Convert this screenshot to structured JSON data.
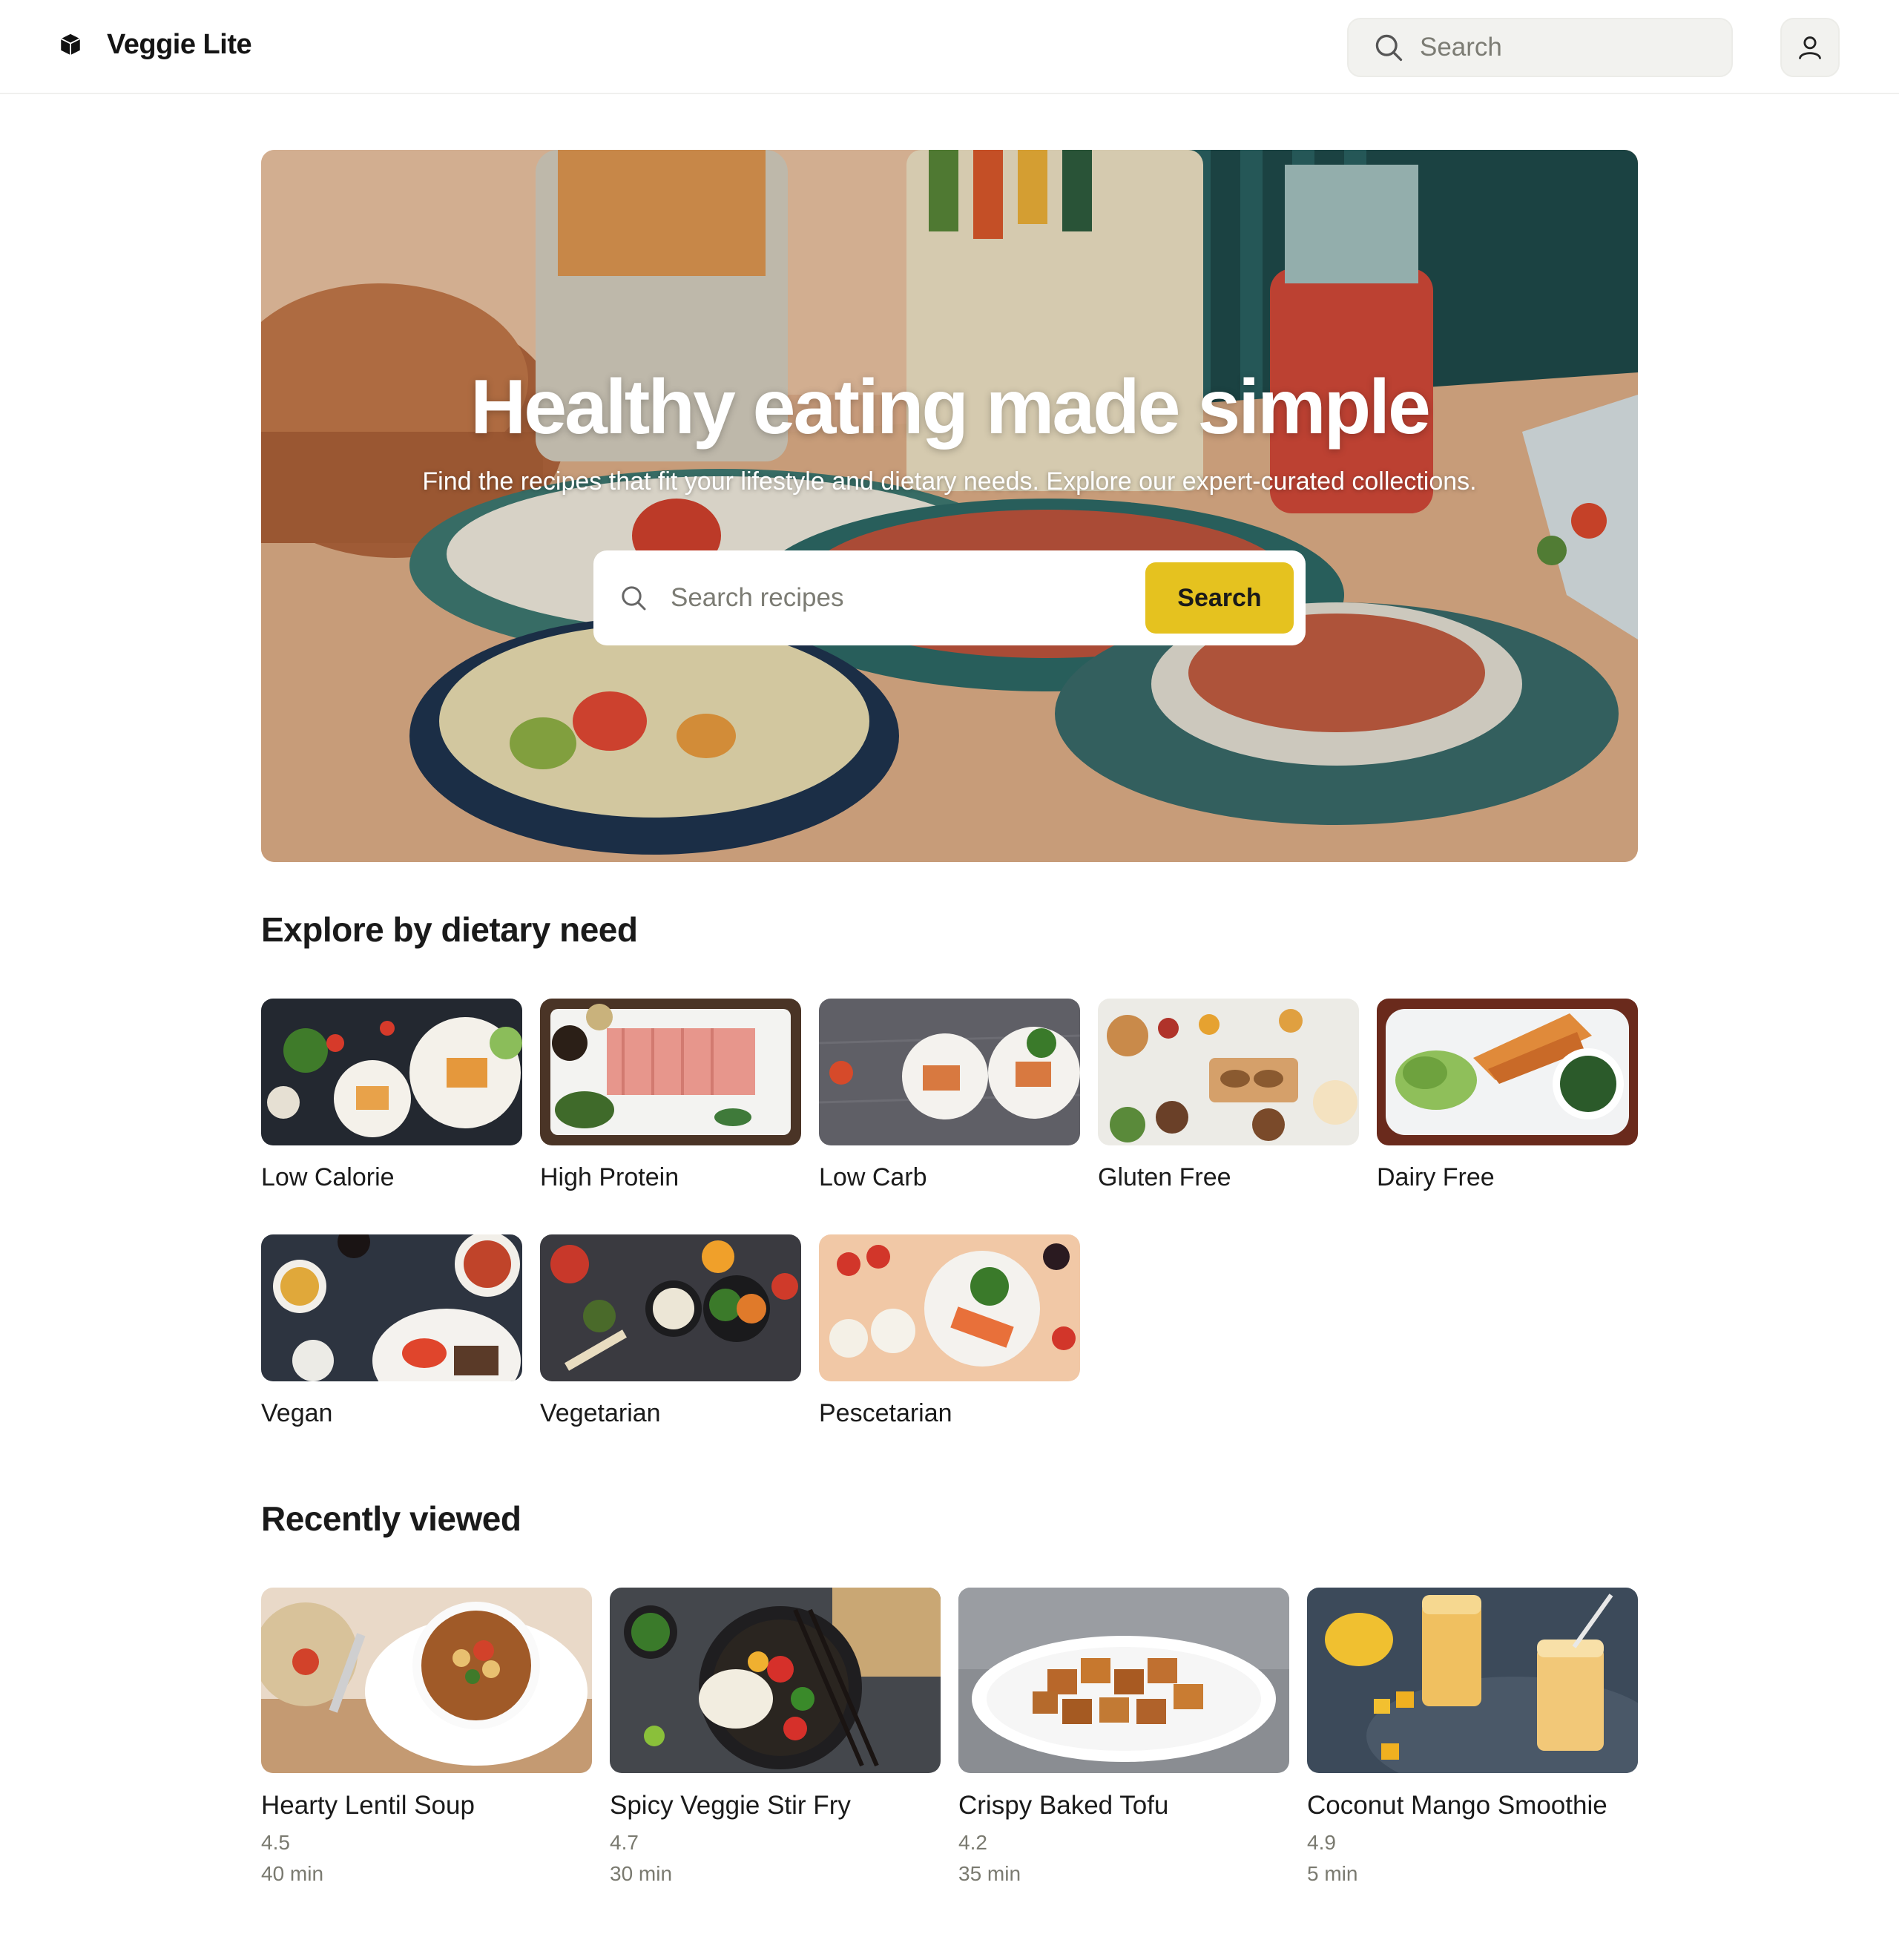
{
  "header": {
    "brand": "Veggie Lite",
    "brand_icon": "cube-icon",
    "search_placeholder": "Search",
    "profile_icon": "user-icon"
  },
  "hero": {
    "title": "Healthy eating made simple",
    "subtitle": "Find the recipes that fit your lifestyle and dietary needs. Explore our expert-curated collections.",
    "search_placeholder": "Search recipes",
    "search_button": "Search"
  },
  "dietary": {
    "title": "Explore by dietary need",
    "items": [
      {
        "label": "Low Calorie"
      },
      {
        "label": "High Protein"
      },
      {
        "label": "Low Carb"
      },
      {
        "label": "Gluten Free"
      },
      {
        "label": "Dairy Free"
      },
      {
        "label": "Vegan"
      },
      {
        "label": "Vegetarian"
      },
      {
        "label": "Pescetarian"
      }
    ]
  },
  "recent": {
    "title": "Recently viewed",
    "items": [
      {
        "name": "Hearty Lentil Soup",
        "rating": "4.5",
        "time": "40 min"
      },
      {
        "name": "Spicy Veggie Stir Fry",
        "rating": "4.7",
        "time": "30 min"
      },
      {
        "name": "Crispy Baked Tofu",
        "rating": "4.2",
        "time": "35 min"
      },
      {
        "name": "Coconut Mango Smoothie",
        "rating": "4.9",
        "time": "5 min"
      }
    ]
  },
  "colors": {
    "accent": "#e5c21f",
    "search_bg": "#f2f2ef"
  }
}
